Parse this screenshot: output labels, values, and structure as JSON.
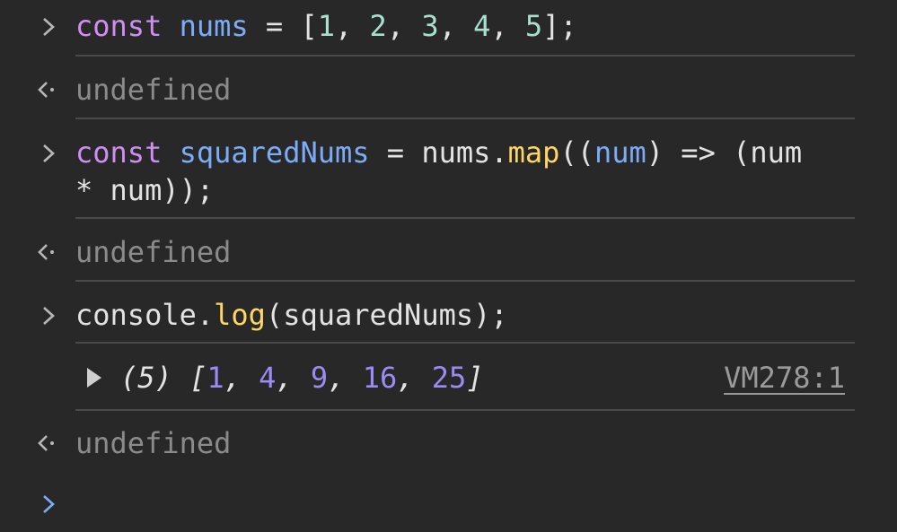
{
  "entries": [
    {
      "type": "input",
      "tokens": [
        {
          "text": "const",
          "cls": "kw"
        },
        {
          "text": " ",
          "cls": "punct"
        },
        {
          "text": "nums",
          "cls": "var"
        },
        {
          "text": " = [",
          "cls": "punct"
        },
        {
          "text": "1",
          "cls": "num-lit"
        },
        {
          "text": ", ",
          "cls": "punct"
        },
        {
          "text": "2",
          "cls": "num-lit"
        },
        {
          "text": ", ",
          "cls": "punct"
        },
        {
          "text": "3",
          "cls": "num-lit"
        },
        {
          "text": ", ",
          "cls": "punct"
        },
        {
          "text": "4",
          "cls": "num-lit"
        },
        {
          "text": ", ",
          "cls": "punct"
        },
        {
          "text": "5",
          "cls": "num-lit"
        },
        {
          "text": "];",
          "cls": "punct"
        }
      ]
    },
    {
      "type": "result",
      "text": "undefined"
    },
    {
      "type": "input",
      "tokens": [
        {
          "text": "const",
          "cls": "kw"
        },
        {
          "text": " ",
          "cls": "punct"
        },
        {
          "text": "squaredNums",
          "cls": "var"
        },
        {
          "text": " = nums.",
          "cls": "punct"
        },
        {
          "text": "map",
          "cls": "fn"
        },
        {
          "text": "((",
          "cls": "punct"
        },
        {
          "text": "num",
          "cls": "var"
        },
        {
          "text": ") => (num\n* num));",
          "cls": "punct"
        }
      ]
    },
    {
      "type": "result",
      "text": "undefined"
    },
    {
      "type": "input",
      "tokens": [
        {
          "text": "console.",
          "cls": "punct"
        },
        {
          "text": "log",
          "cls": "fn"
        },
        {
          "text": "(squaredNums);",
          "cls": "punct"
        }
      ]
    },
    {
      "type": "log",
      "tokens": [
        {
          "text": "(5) [",
          "cls": "log-out"
        },
        {
          "text": "1",
          "cls": "log-num"
        },
        {
          "text": ", ",
          "cls": "log-out"
        },
        {
          "text": "4",
          "cls": "log-num"
        },
        {
          "text": ", ",
          "cls": "log-out"
        },
        {
          "text": "9",
          "cls": "log-num"
        },
        {
          "text": ", ",
          "cls": "log-out"
        },
        {
          "text": "16",
          "cls": "log-num"
        },
        {
          "text": ", ",
          "cls": "log-out"
        },
        {
          "text": "25",
          "cls": "log-num"
        },
        {
          "text": "]",
          "cls": "log-out"
        }
      ],
      "source_link": "VM278:1"
    },
    {
      "type": "result",
      "text": "undefined"
    }
  ],
  "prompt_icon": "chevron-right-icon",
  "result_icon": "return-arrow-icon",
  "expand_icon": "triangle-right-icon",
  "colors": {
    "background": "#282828",
    "keyword": "#cf8ef4",
    "variable": "#7cacf8",
    "number": "#a8e0d0",
    "function": "#fdd663",
    "muted": "#8b8b8b",
    "log_number": "#9b8cf3",
    "prompt_active": "#7cacf8"
  }
}
